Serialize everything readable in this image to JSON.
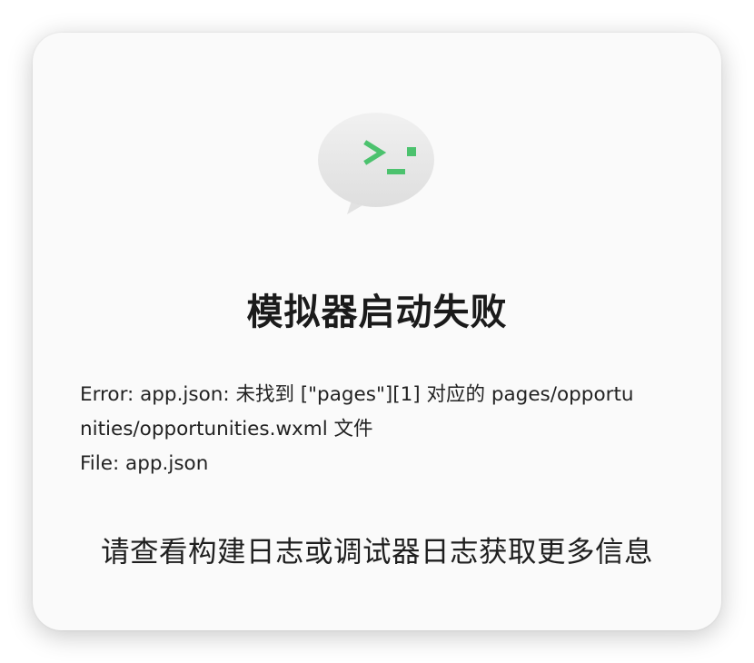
{
  "dialog": {
    "icon": "terminal-chat-bubble-icon",
    "accent_color": "#4cc26e",
    "title": "模拟器启动失败",
    "error_lines": [
      "Error: app.json: 未找到 [\"pages\"][1] 对应的 pages/opportu",
      "nities/opportunities.wxml 文件",
      "File: app.json"
    ],
    "hint": "请查看构建日志或调试器日志获取更多信息"
  }
}
